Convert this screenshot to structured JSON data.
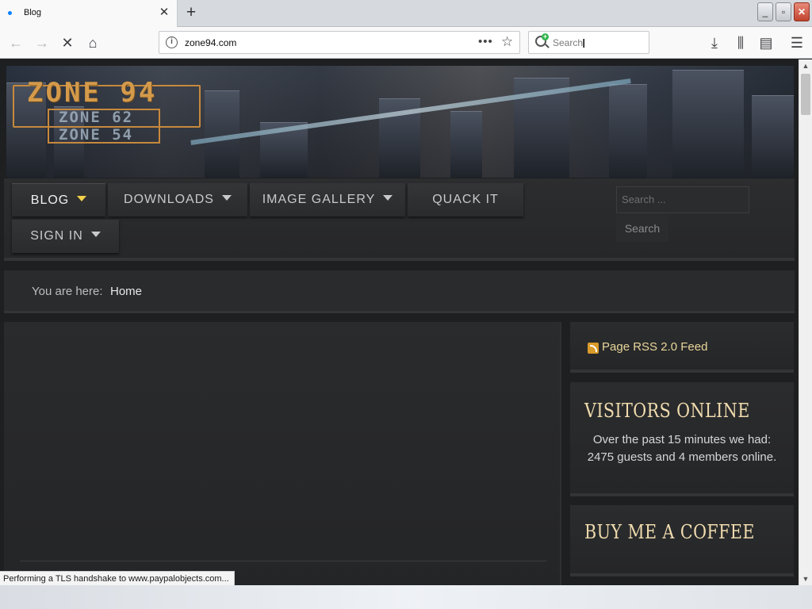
{
  "browser": {
    "tab_title": "Blog",
    "tab_close": "✕",
    "new_tab": "+",
    "url": "zone94.com",
    "search_placeholder": "Search",
    "status": "Performing a TLS handshake to www.paypalobjects.com..."
  },
  "site": {
    "logo": {
      "main": "ZONE 94",
      "sub1": "ZONE 62",
      "sub2": "ZONE 54"
    },
    "menu": [
      {
        "label": "BLOG"
      },
      {
        "label": "DOWNLOADS"
      },
      {
        "label": "IMAGE GALLERY"
      },
      {
        "label": "QUACK IT"
      },
      {
        "label": "SIGN IN"
      }
    ],
    "search": {
      "placeholder": "Search ...",
      "button": "Search"
    },
    "breadcrumb": {
      "label": "You are here:",
      "current": "Home"
    },
    "sidebar": {
      "rss": "Page RSS 2.0 Feed",
      "visitors_title": "VISITORS ONLINE",
      "visitors_text": "Over the past 15 minutes we had: 2475 guests and 4 members online.",
      "coffee_title": "BUY ME A COFFEE"
    }
  },
  "icons": [
    "globe-dot-icon",
    "close-icon",
    "plus-icon",
    "back-icon",
    "forward-icon",
    "stop-icon",
    "home-icon",
    "info-icon",
    "more-icon",
    "star-icon",
    "search-icon",
    "download-icon",
    "library-icon",
    "sidebar-icon",
    "menu-icon",
    "rss-icon",
    "caret-down-icon"
  ],
  "colors": {
    "accent": "#f2d04a",
    "link": "#e9d79a",
    "title": "#f0dcae",
    "page_bg": "#1e1f21"
  }
}
